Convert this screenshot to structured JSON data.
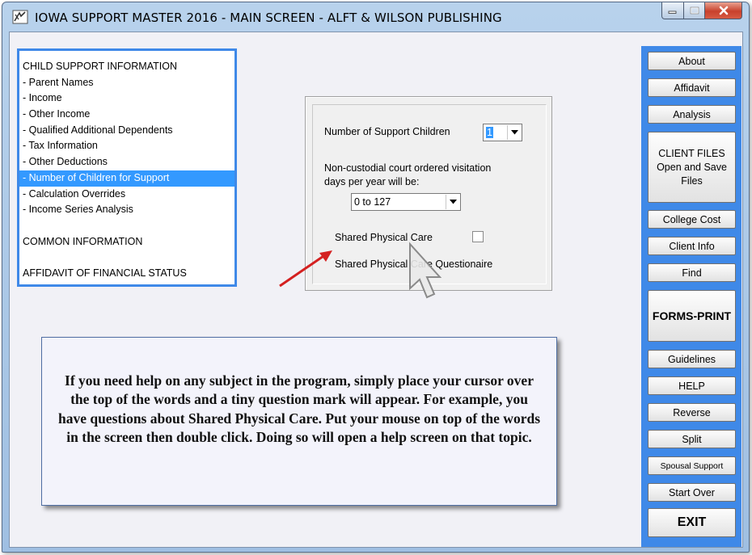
{
  "window": {
    "title": "IOWA SUPPORT MASTER 2016 - MAIN SCREEN - ALFT & WILSON PUBLISHING"
  },
  "nav": {
    "items": [
      {
        "label": "CHILD SUPPORT INFORMATION"
      },
      {
        "label": "- Parent Names"
      },
      {
        "label": "- Income"
      },
      {
        "label": "- Other Income"
      },
      {
        "label": "- Qualified Additional Dependents"
      },
      {
        "label": "- Tax Information"
      },
      {
        "label": "- Other Deductions"
      },
      {
        "label": "- Number of Children for Support"
      },
      {
        "label": "- Calculation Overrides"
      },
      {
        "label": "- Income Series Analysis"
      },
      {
        "label": "COMMON INFORMATION"
      },
      {
        "label": "AFFIDAVIT OF FINANCIAL STATUS"
      }
    ],
    "selected": "- Number of Children for Support"
  },
  "panel": {
    "children_label": "Number of Support Children",
    "children_value": "1",
    "visitation_label_line1": "Non-custodial court ordered visitation",
    "visitation_label_line2": "days per year will be:",
    "visitation_value": "0 to 127",
    "shared_care_label": "Shared Physical Care",
    "shared_care_checked": false,
    "questionaire_label": "Shared Physical Care Questionaire"
  },
  "help": {
    "text": "If you need help on any subject in the program, simply place your cursor over the top of the words and a tiny question mark will appear. For example, you have questions about Shared Physical Care. Put your mouse on top of the words in the screen then double click. Doing so will open a help screen on that topic."
  },
  "buttons": {
    "about": "About",
    "affidavit": "Affidavit",
    "analysis": "Analysis",
    "client_files": "CLIENT FILES Open and Save Files",
    "college_cost": "College Cost",
    "client_info": "Client Info",
    "find": "Find",
    "forms_print": "FORMS-PRINT",
    "guidelines": "Guidelines",
    "help": "HELP",
    "reverse": "Reverse",
    "split": "Split",
    "spousal_support": "Spousal Support",
    "start_over": "Start Over",
    "exit": "EXIT"
  },
  "colors": {
    "accent_blue": "#3f89e8",
    "selection_blue": "#3399ff",
    "arrow_red": "#d42020"
  }
}
